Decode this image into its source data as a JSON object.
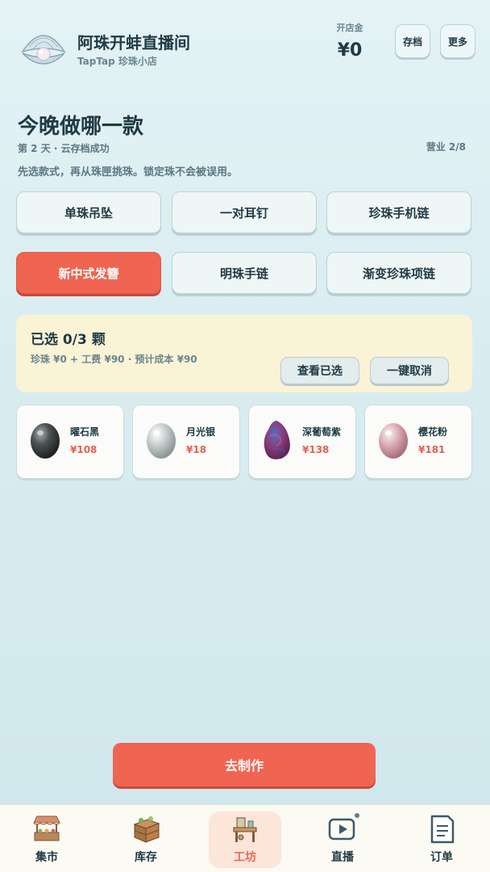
{
  "header": {
    "shop_name": "阿珠开蚌直播间",
    "shop_sub": "TapTap 珍珠小店",
    "fund_label": "开店金",
    "fund_value": "¥0",
    "save_label": "存档",
    "more_label": "更多"
  },
  "main": {
    "title": "今晚做哪一款",
    "day_info": "第 2 天 · 云存档成功",
    "business": "营业 2/8",
    "hint": "先选款式，再从珠匣挑珠。锁定珠不会被误用。"
  },
  "styles": [
    {
      "label": "单珠吊坠",
      "active": false
    },
    {
      "label": "一对耳钉",
      "active": false
    },
    {
      "label": "珍珠手机链",
      "active": false
    },
    {
      "label": "新中式发簪",
      "active": true
    },
    {
      "label": "明珠手链",
      "active": false
    },
    {
      "label": "渐变珍珠项链",
      "active": false
    }
  ],
  "selection": {
    "title": "已选 0/3 颗",
    "cost": "珍珠 ¥0 + 工费 ¥90 · 预计成本 ¥90",
    "view_label": "查看已选",
    "clear_label": "一键取消"
  },
  "pearls": [
    {
      "name": "曜石黑",
      "price": "¥108",
      "color": "#3d4244"
    },
    {
      "name": "月光银",
      "price": "¥18",
      "color": "#b9c2c2"
    },
    {
      "name": "深葡萄紫",
      "price": "¥138",
      "color": "#7a3c6c"
    },
    {
      "name": "樱花粉",
      "price": "¥181",
      "color": "#d6a3ad"
    }
  ],
  "go_button": "去制作",
  "nav": [
    {
      "label": "集市",
      "icon": "market-stall-icon",
      "active": false
    },
    {
      "label": "库存",
      "icon": "crate-icon",
      "active": false
    },
    {
      "label": "工坊",
      "icon": "workbench-icon",
      "active": true
    },
    {
      "label": "直播",
      "icon": "play-screen-icon",
      "active": false
    },
    {
      "label": "订单",
      "icon": "order-list-icon",
      "active": false
    }
  ],
  "colors": {
    "accent": "#ef6552",
    "panel": "#fbf3d6",
    "text": "#1f3a44"
  }
}
